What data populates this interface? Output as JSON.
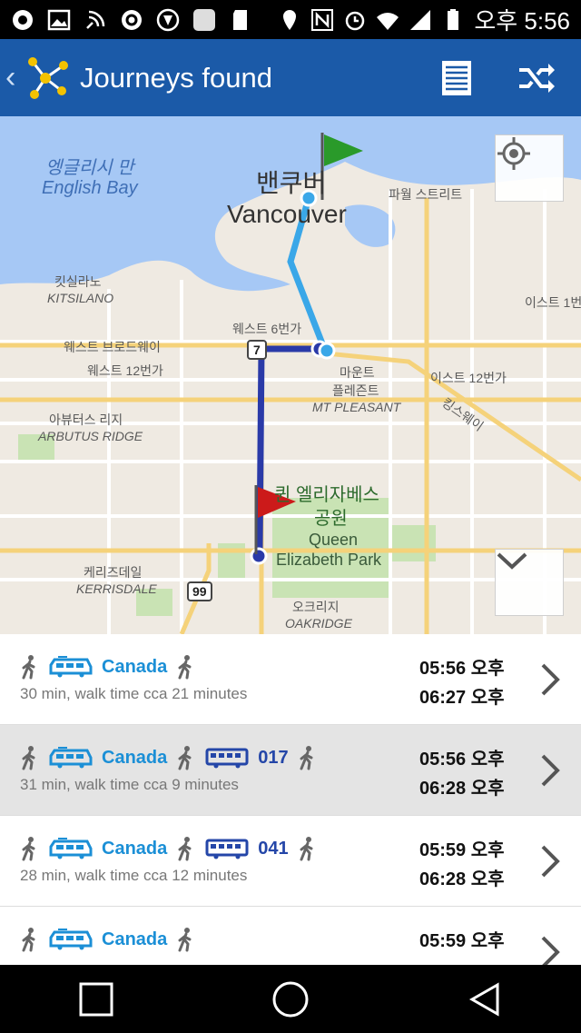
{
  "status_bar": {
    "time": "오후 5:56",
    "icons": [
      "notification-icon",
      "image-icon",
      "nfc-icon",
      "vpn-icon",
      "shield-icon",
      "app-icon",
      "sd-card-icon",
      "location-icon",
      "nfc-n-icon",
      "alarm-icon",
      "wifi-icon",
      "signal-icon",
      "battery-icon"
    ]
  },
  "app_bar": {
    "title": "Journeys found",
    "back_icon": "chevron-left-icon",
    "logo_icon": "network-logo-icon",
    "actions": [
      "list-view-icon",
      "shuffle-icon"
    ]
  },
  "map": {
    "labels": {
      "english_bay_ko": "엥글리시 만",
      "english_bay": "English Bay",
      "vancouver_ko": "밴쿠버",
      "vancouver": "Vancouver",
      "powell_st": "파월 스트리트",
      "kitsilano_ko": "킷실라노",
      "kitsilano": "KITSILANO",
      "east_1st": "이스트 1번",
      "west_6th": "웨스트 6번가",
      "west_broadway": "웨스트 브로드웨이",
      "west_12th": "웨스트 12번가",
      "hwy7": "7",
      "mount_pleasant_ko1": "마운트",
      "mount_pleasant_ko2": "플레즌트",
      "mount_pleasant": "MT PLEASANT",
      "east_12th": "이스트 12번가",
      "kingsway": "킹스웨이",
      "arbutus_ridge_ko": "아뷰터스 리지",
      "arbutus_ridge": "ARBUTUS RIDGE",
      "qe_park_ko1": "퀸 엘리자베스",
      "qe_park_ko2": "공원",
      "qe_park_en1": "Queen",
      "qe_park_en2": "Elizabeth Park",
      "kerrisdale_ko": "케리즈데일",
      "kerrisdale": "KERRISDALE",
      "hwy99": "99",
      "oakridge_ko": "오크리지",
      "oakridge": "OAKRIDGE"
    },
    "buttons": [
      "my-location-icon",
      "collapse-map-icon"
    ]
  },
  "journeys": [
    {
      "segments": [
        {
          "mode": "walk"
        },
        {
          "mode": "train",
          "label": "Canada"
        },
        {
          "mode": "walk"
        }
      ],
      "summary": "30 min, walk time cca 21 minutes",
      "depart": "05:56 오후",
      "arrive": "06:27 오후",
      "selected": false
    },
    {
      "segments": [
        {
          "mode": "walk"
        },
        {
          "mode": "train",
          "label": "Canada"
        },
        {
          "mode": "walk"
        },
        {
          "mode": "bus",
          "label": "017"
        },
        {
          "mode": "walk"
        }
      ],
      "summary": "31 min, walk time cca 9 minutes",
      "depart": "05:56 오후",
      "arrive": "06:28 오후",
      "selected": true
    },
    {
      "segments": [
        {
          "mode": "walk"
        },
        {
          "mode": "train",
          "label": "Canada"
        },
        {
          "mode": "walk"
        },
        {
          "mode": "bus",
          "label": "041"
        },
        {
          "mode": "walk"
        }
      ],
      "summary": "28 min, walk time cca 12 minutes",
      "depart": "05:59 오후",
      "arrive": "06:28 오후",
      "selected": false
    },
    {
      "segments": [
        {
          "mode": "walk"
        },
        {
          "mode": "train",
          "label": "Canada"
        },
        {
          "mode": "walk"
        }
      ],
      "summary": "",
      "depart": "05:59 오후",
      "arrive": "",
      "selected": false
    }
  ],
  "nav_bar": {
    "buttons": [
      "recents-button",
      "home-button",
      "back-button"
    ]
  },
  "colors": {
    "app_bar": "#1b5aa8",
    "train_line": "#1b8fd6",
    "bus_line": "#2446a8",
    "route_light": "#3aa7e8",
    "route_dark": "#2a3aa8"
  }
}
